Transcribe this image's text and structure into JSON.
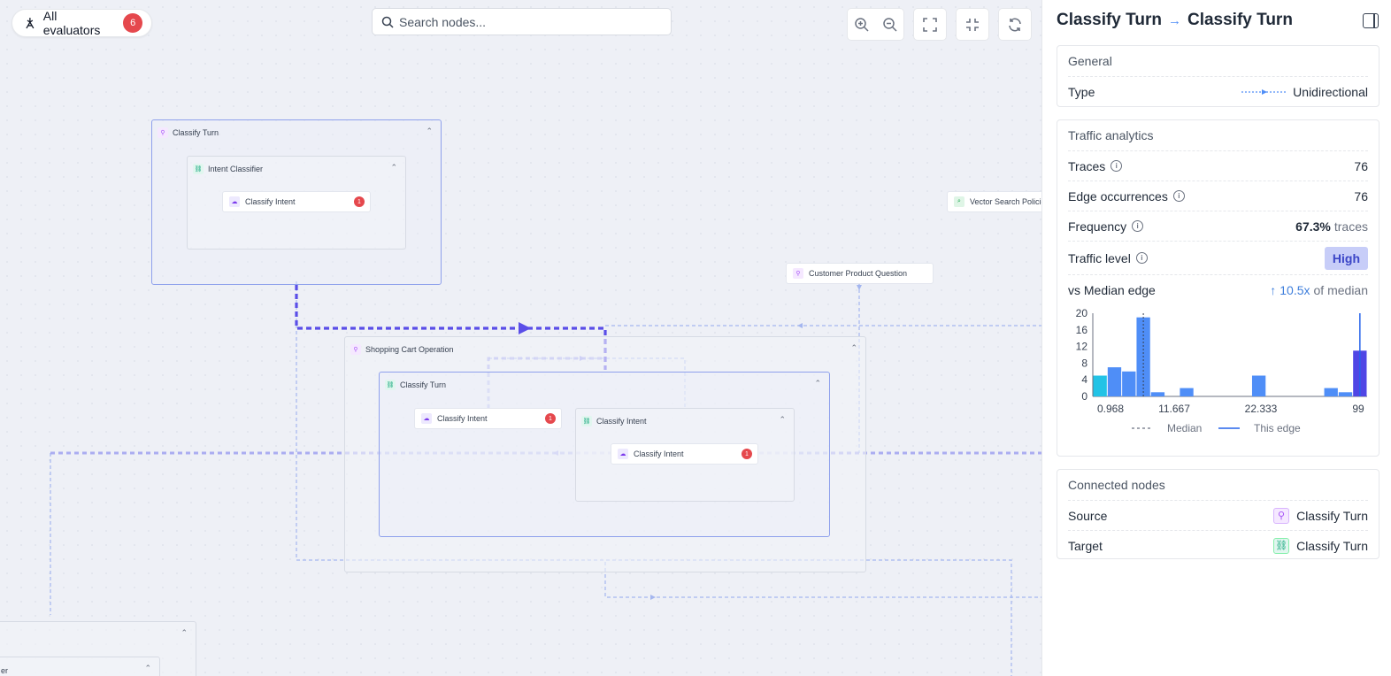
{
  "toolbar": {
    "evaluators_label": "All evaluators",
    "evaluators_count": "6",
    "search_placeholder": "Search nodes..."
  },
  "canvas": {
    "groups": {
      "classify_turn_top": "Classify Turn",
      "intent_classifier": "Intent Classifier",
      "shopping_cart": "Shopping Cart Operation",
      "classify_turn_inner": "Classify Turn",
      "classify_intent_group": "Classify Intent",
      "bottom_left_partial": "er"
    },
    "nodes": {
      "classify_intent_1": "Classify Intent",
      "classify_intent_2": "Classify Intent",
      "classify_intent_3": "Classify Intent",
      "customer_product_question": "Customer Product Question",
      "vector_search": "Vector Search Policie"
    },
    "error_count": "1"
  },
  "panel": {
    "source_title": "Classify Turn",
    "target_title": "Classify Turn",
    "general": {
      "title": "General",
      "type_label": "Type",
      "type_value": "Unidirectional"
    },
    "traffic": {
      "title": "Traffic analytics",
      "traces_label": "Traces",
      "traces_value": "76",
      "occurrences_label": "Edge occurrences",
      "occurrences_value": "76",
      "frequency_label": "Frequency",
      "frequency_value": "67.3%",
      "frequency_unit": "traces",
      "level_label": "Traffic level",
      "level_value": "High",
      "median_label": "vs Median edge",
      "median_value": "10.5x",
      "median_suffix": "of median"
    },
    "connected": {
      "title": "Connected nodes",
      "source_label": "Source",
      "source_value": "Classify Turn",
      "target_label": "Target",
      "target_value": "Classify Turn"
    }
  },
  "chart_data": {
    "type": "bar",
    "title": "",
    "xlabel": "",
    "ylabel": "",
    "x_ticks": [
      "0.968",
      "11.667",
      "22.333",
      "99"
    ],
    "y_ticks": [
      0,
      4,
      8,
      12,
      16,
      20
    ],
    "ylim": [
      0,
      20
    ],
    "bins": [
      {
        "value": 5,
        "color": "#22c3e6"
      },
      {
        "value": 7,
        "color": "#4f8ef7"
      },
      {
        "value": 6,
        "color": "#4f8ef7"
      },
      {
        "value": 19,
        "color": "#4f8ef7"
      },
      {
        "value": 1,
        "color": "#4f8ef7"
      },
      {
        "value": 0,
        "color": "#4f8ef7"
      },
      {
        "value": 2,
        "color": "#4f8ef7"
      },
      {
        "value": 0,
        "color": "#4f8ef7"
      },
      {
        "value": 0,
        "color": "#4f8ef7"
      },
      {
        "value": 0,
        "color": "#4f8ef7"
      },
      {
        "value": 0,
        "color": "#4f8ef7"
      },
      {
        "value": 5,
        "color": "#4f8ef7"
      },
      {
        "value": 0,
        "color": "#4f8ef7"
      },
      {
        "value": 0,
        "color": "#4f8ef7"
      },
      {
        "value": 0,
        "color": "#4f8ef7"
      },
      {
        "value": 0,
        "color": "#4f8ef7"
      },
      {
        "value": 2,
        "color": "#4f8ef7"
      },
      {
        "value": 1,
        "color": "#4f8ef7"
      },
      {
        "value": 11,
        "color": "#4f46e5"
      }
    ],
    "median_bin": 3,
    "this_edge_bin": 18,
    "legend": [
      "Median",
      "This edge"
    ],
    "legend_position": "bottom"
  }
}
